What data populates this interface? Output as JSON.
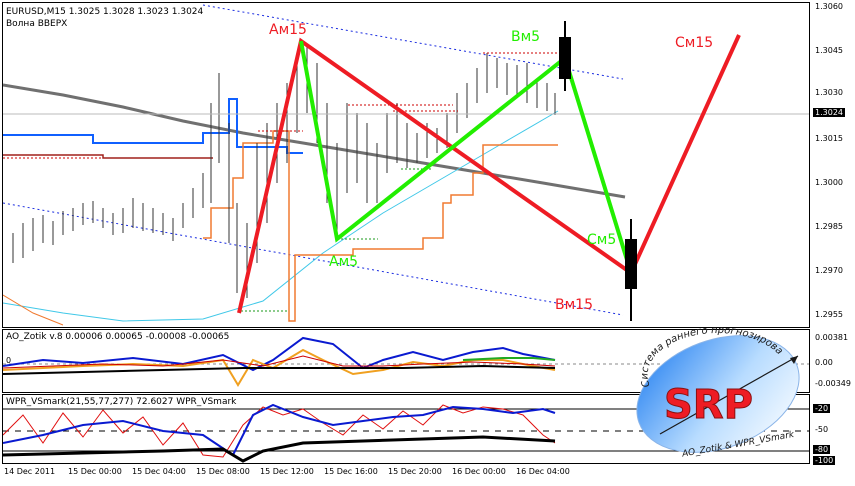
{
  "main_pane": {
    "symbol_line": "EURUSD,M15  1.3025 1.3028 1.3023 1.3024",
    "indicator_name": "Волна ВВЕРХ",
    "price_ticks": [
      "1.3060",
      "1.3045",
      "1.3030",
      "1.3015",
      "1.3000",
      "1.2985",
      "1.2970",
      "1.2955"
    ],
    "current_price": "1.3024",
    "wave_labels": {
      "am15": "Ам15",
      "vm5": "Вм5",
      "cm15": "См15",
      "am5": "Ам5",
      "cm5": "См5",
      "vm15": "Вм15"
    }
  },
  "ao_pane": {
    "title": "AO_Zotik v.8 0.00006 0.00065 -0.00008 -0.00065",
    "ticks": [
      "0.00381",
      "0.00",
      "-0.00349"
    ],
    "zero_label": "0"
  },
  "wpr_pane": {
    "title": "WPR_VSmark(21,55,77,277) 72.6027  WPR_VSmark",
    "ticks": [
      "-20",
      "-50",
      "-80",
      "-100"
    ]
  },
  "time_axis": [
    "14 Dec 2011",
    "15 Dec 00:00",
    "15 Dec 04:00",
    "15 Dec 08:00",
    "15 Dec 12:00",
    "15 Dec 16:00",
    "15 Dec 20:00",
    "16 Dec 00:00",
    "16 Dec 04:00"
  ],
  "logo": {
    "letters": "SRP",
    "arc_text": "Система раннего прогнозирования",
    "bottom_text": "AO_Zotik & WPR_VSmark"
  },
  "colors": {
    "red_wave": "#ee1c24",
    "green_wave": "#22ee00",
    "blue_line": "#1060ff",
    "gray_ma": "#707070",
    "orange_line": "#f07a30",
    "cyan_line": "#40c8e8"
  }
}
